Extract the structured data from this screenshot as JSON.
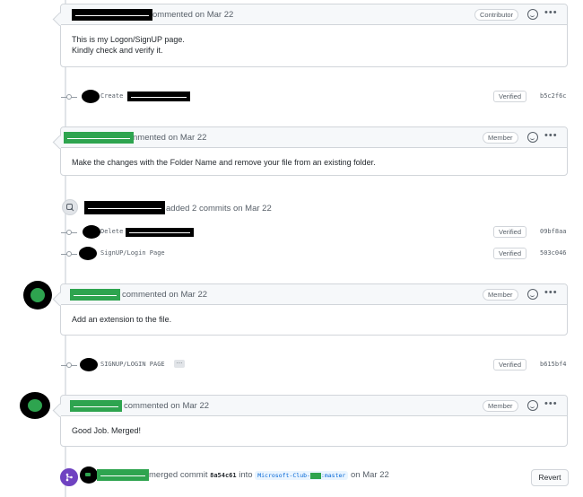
{
  "comments": [
    {
      "header_text": "ommented on Mar 22",
      "badge": "Contributor",
      "body_lines": [
        "This is my Logon/SignUP page.",
        "Kindly check and verify it."
      ]
    },
    {
      "header_text": "nmented on Mar 22",
      "badge": "Member",
      "body_lines": [
        "Make the changes with the Folder Name and remove your file from an existing folder."
      ]
    },
    {
      "header_text": "commented on Mar 22",
      "badge": "Member",
      "body_lines": [
        "Add an extension to the file."
      ]
    },
    {
      "header_text": "commented on Mar 22",
      "badge": "Member",
      "body_lines": [
        "Good Job. Merged!"
      ]
    }
  ],
  "commits": [
    {
      "message": "Create",
      "verified": "Verified",
      "sha": "b5c2f6c"
    },
    {
      "message": "Delete",
      "verified": "Verified",
      "sha": "09bf8aa"
    },
    {
      "message": "SignUP/Login Page",
      "verified": "Verified",
      "sha": "503c046"
    },
    {
      "message": "SIGNUP/LOGIN PAGE",
      "verified": "Verified",
      "sha": "b615bf4"
    }
  ],
  "event": {
    "text": "added 2 commits on Mar 22"
  },
  "merge": {
    "text_prefix": "merged commit",
    "commit_sha": "8a54c61",
    "into": "into",
    "branch_prefix": "Microsoft-Club-",
    "branch_suffix": ":master",
    "date": "on Mar 22",
    "revert_label": "Revert"
  },
  "ui": {
    "ellipsis": "…",
    "menu_dots": "•••"
  },
  "colors": {
    "redaction_green": "#2ea44f",
    "redaction_black": "#000000",
    "timeline": "#e1e4e8"
  }
}
